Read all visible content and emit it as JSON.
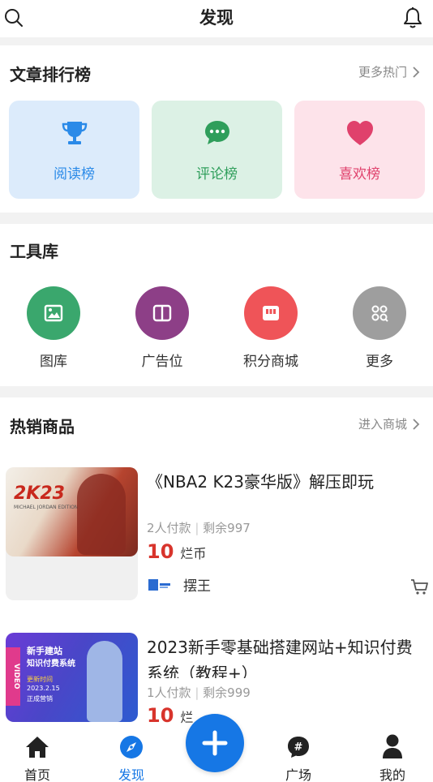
{
  "header": {
    "title": "发现"
  },
  "rank_section": {
    "title": "文章排行榜",
    "more": "更多热门",
    "cards": [
      {
        "label": "阅读榜",
        "color": "#2a8ae8",
        "bg": "#dcebfb",
        "icon": "trophy-icon"
      },
      {
        "label": "评论榜",
        "color": "#2f9e5b",
        "bg": "#dcf1e5",
        "icon": "comment-icon"
      },
      {
        "label": "喜欢榜",
        "color": "#e0416c",
        "bg": "#fde3ea",
        "icon": "heart-icon"
      }
    ]
  },
  "tools_section": {
    "title": "工具库",
    "items": [
      {
        "label": "图库",
        "color": "#3aa76d",
        "icon": "image-icon"
      },
      {
        "label": "广告位",
        "color": "#8d3f87",
        "icon": "book-icon"
      },
      {
        "label": "积分商城",
        "color": "#ef5458",
        "icon": "store-icon"
      },
      {
        "label": "更多",
        "color": "#9e9e9e",
        "icon": "more-grid-icon"
      }
    ]
  },
  "goods_section": {
    "title": "热销商品",
    "more": "进入商城",
    "products": [
      {
        "title": "《NBA2 K23豪华版》解压即玩",
        "img_text": "2K23",
        "img_caption": "MICHAEL JORDAN EDITION",
        "paid": "2人付款",
        "stock": "剩余997",
        "price": "10",
        "unit": "烂币",
        "seller": "摆王"
      },
      {
        "title": "2023新手零基础搭建网站+知识付费系统（教程+）",
        "img_text_lines": [
          "新手建站",
          "知识付费系统"
        ],
        "img_side": "VIDEO",
        "img_tag": "更新时间",
        "img_date": "2023.2.15",
        "img_note": "正成营销",
        "paid": "1人付款",
        "stock": "剩余999",
        "price": "10",
        "unit": "烂"
      }
    ]
  },
  "tabbar": {
    "tabs": [
      {
        "label": "首页",
        "icon": "home-icon"
      },
      {
        "label": "发现",
        "icon": "compass-icon",
        "active": true
      },
      {
        "label": "广场",
        "icon": "hashtag-icon"
      },
      {
        "label": "我的",
        "icon": "user-icon"
      }
    ],
    "fab_icon": "plus-icon"
  },
  "colors": {
    "accent": "#1677e5",
    "price": "#d8342c"
  }
}
